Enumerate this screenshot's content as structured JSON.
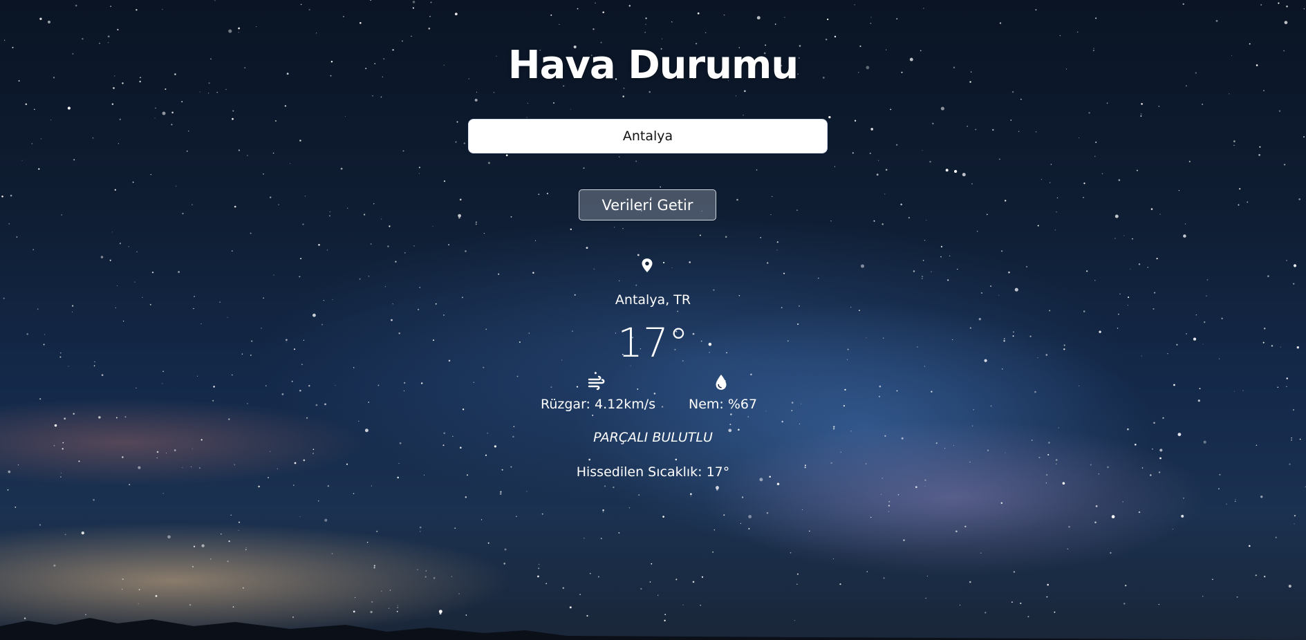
{
  "app": {
    "title": "Hava Durumu"
  },
  "search": {
    "value": "Antalya",
    "button_label": "Verileri Getir"
  },
  "weather": {
    "location_icon": "map-pin-icon",
    "location": "Antalya, TR",
    "temperature": "17°",
    "wind_icon": "wind-icon",
    "wind": "Rüzgar: 4.12km/s",
    "humidity_icon": "water-drop-icon",
    "humidity": "Nem: %67",
    "description": "PARÇALI BULUTLU",
    "feels_like": "Hissedilen Sıcaklık: 17°"
  },
  "colors": {
    "text": "#ffffff",
    "sky_dark": "#0a1424",
    "sky_mid": "#14294a",
    "input_bg": "#ffffff"
  }
}
